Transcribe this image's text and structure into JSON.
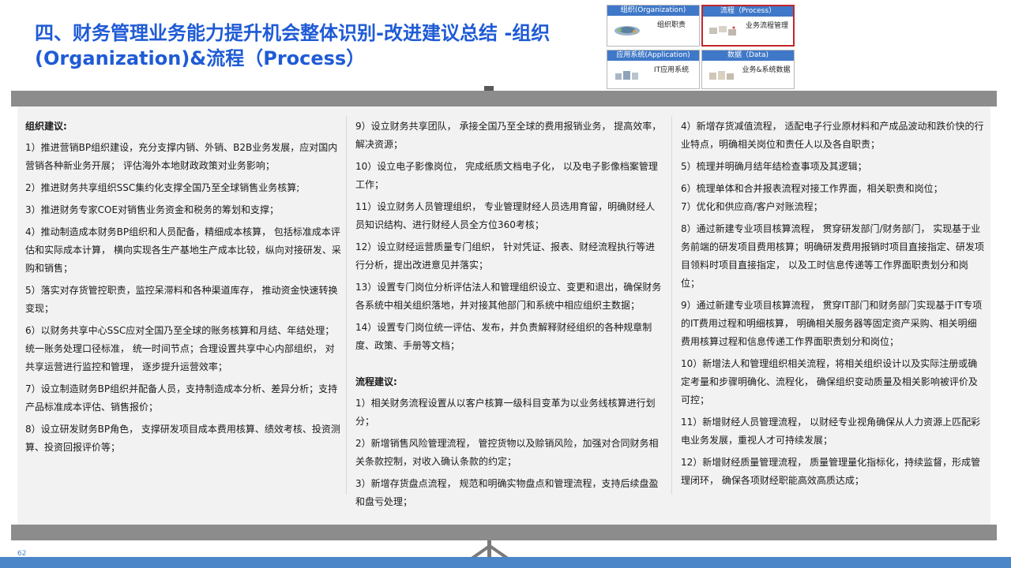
{
  "title": "四、财务管理业务能力提升机会整体识别-改进建议总结 -组织(Organization)&流程（Process）",
  "matrix": {
    "org": {
      "header": "组织(Organization)",
      "label": "组织职责"
    },
    "proc": {
      "header": "流程（Process）",
      "label": "业务流程管理"
    },
    "app": {
      "header": "应用系统(Application)",
      "label": "IT应用系统"
    },
    "data": {
      "header": "数据（Data)",
      "label": "业务&系统数据"
    }
  },
  "col1": {
    "heading": "组织建议:",
    "items": [
      "1）推进营销BP组织建设，充分支撑内销、外销、B2B业务发展，应对国内营销各种新业务开展； 评估海外本地财政政策对业务影响；",
      "2）推进财务共享组织SSC集约化支撑全国乃至全球销售业务核算;",
      "3）推进财务专家COE对销售业务资金和税务的筹划和支撑；",
      "4）推动制造成本财务BP组织和人员配备，精细成本核算， 包括标准成本评估和实际成本计算， 横向实现各生产基地生产成本比较，纵向对接研发、采购和销售；",
      "5）落实对存货管控职责，监控呆滞料和各种渠道库存， 推动资金快速转换变现；",
      "6）以财务共享中心SSC应对全国乃至全球的账务核算和月结、年结处理；统一账务处理口径标准， 统一时间节点；合理设置共享中心内部组织， 对共享运营进行监控和管理， 逐步提升运营效率；",
      "7）设立制造财务BP组织并配备人员，支持制造成本分析、差异分析；支持产品标准成本评估、销售报价；",
      "8）设立研发财务BP角色， 支撑研发项目成本费用核算、绩效考核、投资测算、投资回报评价等；"
    ]
  },
  "col2": {
    "items": [
      "9）设立财务共享团队， 承接全国乃至全球的费用报销业务， 提高效率，解决资源；",
      "10）设立电子影像岗位， 完成纸质文档电子化， 以及电子影像档案管理工作；",
      "11）设立财务人员管理组织， 专业管理财经人员选用育留，明确财经人员知识结构、进行财经人员全方位360考核；",
      "12）设立财经运营质量专门组织， 针对凭证、报表、财经流程执行等进行分析，提出改进意见并落实；",
      "13）设置专门岗位分析评估法人和管理组织设立、变更和退出，确保财务各系统中相关组织落地，并对接其他部门和系统中相应组织主数据；",
      "14）设置专门岗位统一评估、发布，并负责解释财经组织的各种规章制度、政策、手册等文档；"
    ],
    "heading": "流程建议:",
    "process": [
      "1）相关财务流程设置从以客户核算一级科目变革为以业务线核算进行划分；",
      "2）新增销售风险管理流程， 管控货物以及赊销风险，加强对合同财务相关条款控制，对收入确认条款的约定；",
      "3）新增存货盘点流程， 规范和明确实物盘点和管理流程，支持后续盘盈和盘亏处理；"
    ]
  },
  "col3": {
    "items": [
      "4）新增存货减值流程， 适配电子行业原材料和产成品波动和跌价快的行业特点，明确相关岗位和责任人以及各自职责；",
      "5）梳理并明确月结年结检查事项及其逻辑；",
      "6）梳理单体和合并报表流程对接工作界面，相关职责和岗位；",
      "7）优化和供应商/客户对账流程；",
      "8）通过新建专业项目核算流程， 贯穿研发部门/财务部门， 实现基于业务前端的研发项目费用核算；明确研发费用报销时项目直接指定、研发项目领料时项目直接指定， 以及工时信息传递等工作界面职责划分和岗位；",
      "9）通过新建专业项目核算流程， 贯穿IT部门和财务部门实现基于IT专项的IT费用过程和明细核算， 明确相关服务器等固定资产采购、相关明细费用核算过程和信息传递工作界面职责划分和岗位；",
      "10）新增法人和管理组织相关流程，将相关组织设计以及实际注册或确定考量和步骤明确化、流程化， 确保组织变动质量及相关影响被评价及可控；",
      "11）新增财经人员管理流程， 以财经专业视角确保从人力资源上匹配彩电业务发展，重视人才可持续发展；",
      "12）新增财经质量管理流程， 质量管理量化指标化，持续监督，形成管理闭环， 确保各项财经职能高效高质达成；"
    ]
  },
  "page_number": "62",
  "colors": {
    "title": "#1f5bd6",
    "matrix_header": "#3f78c8",
    "selected_border": "#c0282e",
    "board_rail": "#8c8c8c",
    "footer": "#4a86c8"
  }
}
